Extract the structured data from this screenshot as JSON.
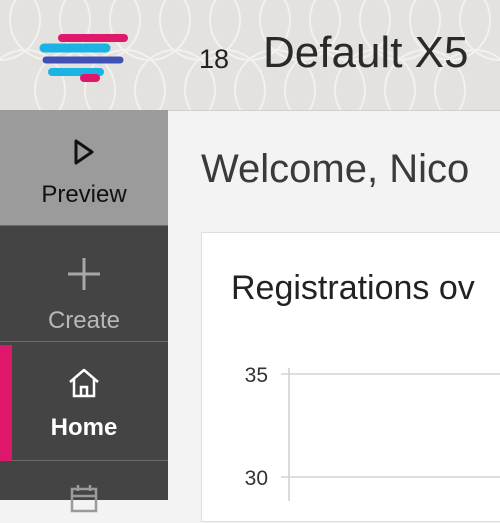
{
  "header": {
    "badge_number": "18",
    "app_title": "Default X5",
    "logo_icon": "brand-logo-icon",
    "logo_colors": [
      "#1bb3e3",
      "#e0186b",
      "#3f51b5"
    ]
  },
  "sidebar": {
    "accent_color": "#e0186b",
    "items": [
      {
        "label": "Preview",
        "icon": "play-icon",
        "state": "highlighted"
      },
      {
        "label": "Create",
        "icon": "plus-icon",
        "state": "default"
      },
      {
        "label": "Home",
        "icon": "home-icon",
        "state": "active"
      },
      {
        "label": "",
        "icon": "calendar-icon",
        "state": "default"
      }
    ]
  },
  "main": {
    "welcome": "Welcome, Nico",
    "card_title": "Registrations ov"
  },
  "chart_data": {
    "type": "line",
    "title": "Registrations ov",
    "yticks": [
      35,
      30
    ],
    "grid": true
  }
}
